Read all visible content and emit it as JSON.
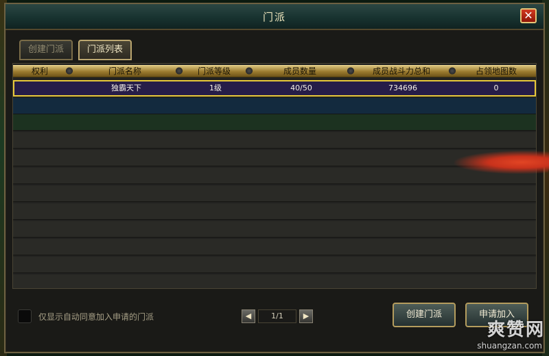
{
  "window": {
    "title": "门派",
    "close_label": "✕"
  },
  "tabs": [
    {
      "label": "创建门派"
    },
    {
      "label": "门派列表"
    }
  ],
  "table": {
    "columns": [
      "权利",
      "门派名称",
      "门派等级",
      "成员数量",
      "成员战斗力总和",
      "占领地图数"
    ],
    "rows": [
      {
        "rights": "",
        "name": "独霸天下",
        "level": "1级",
        "members": "40/50",
        "power": "734696",
        "maps": "0"
      }
    ]
  },
  "footer": {
    "checkbox_label": "仅显示自动同意加入申请的门派",
    "page": "1/1",
    "prev_icon": "◀",
    "next_icon": "▶",
    "create_button": "创建门派",
    "apply_button": "申请加入"
  },
  "watermark": {
    "main": "爽赞网",
    "sub": "shuangzan.com"
  },
  "colors": {
    "accent": "#e8c93a",
    "selected_row": "#261d48",
    "header_gold": "#c9ab5e"
  }
}
